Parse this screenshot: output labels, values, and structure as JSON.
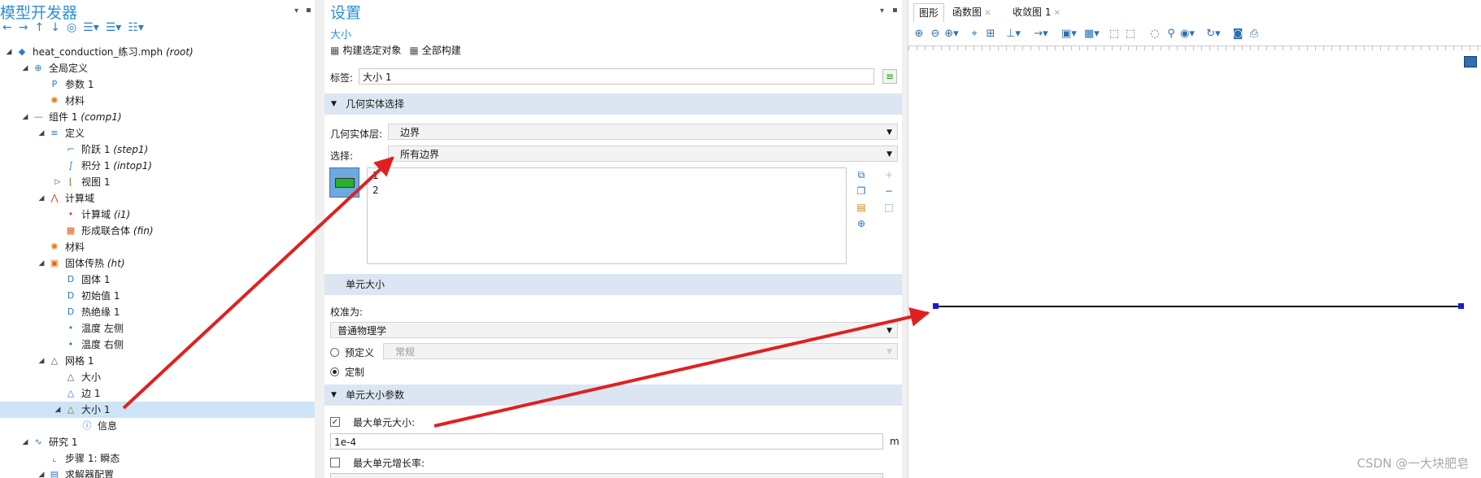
{
  "left": {
    "title": "模型开发器",
    "tree": [
      {
        "label": "heat_conduction_练习.mph",
        "tag": "(root)",
        "icon": "◆",
        "color": "#2b79c2",
        "level": 0,
        "exp": "◢"
      },
      {
        "label": "全局定义",
        "tag": "",
        "icon": "⊕",
        "color": "#2b79c2",
        "level": 1,
        "exp": "◢"
      },
      {
        "label": "参数 1",
        "tag": "",
        "icon": "P",
        "color": "#2b79c2",
        "level": 2,
        "exp": ""
      },
      {
        "label": "材料",
        "tag": "",
        "icon": "✺",
        "color": "#e07d10",
        "level": 2,
        "exp": ""
      },
      {
        "label": "组件 1",
        "tag": "(comp1)",
        "icon": "—",
        "color": "#2b79c2",
        "level": 1,
        "exp": "◢"
      },
      {
        "label": "定义",
        "tag": "",
        "icon": "≡",
        "color": "#2b79c2",
        "level": 2,
        "exp": "◢"
      },
      {
        "label": "阶跃 1",
        "tag": "(step1)",
        "icon": "⌐",
        "color": "#2b79c2",
        "level": 3,
        "exp": ""
      },
      {
        "label": "积分 1",
        "tag": "(intop1)",
        "icon": "∫",
        "color": "#2b79c2",
        "level": 3,
        "exp": ""
      },
      {
        "label": "视图 1",
        "tag": "",
        "icon": "⌊",
        "color": "#4a8a2a",
        "level": 3,
        "exp": "▷"
      },
      {
        "label": "计算域",
        "tag": "",
        "icon": "⋀",
        "color": "#d04020",
        "level": 2,
        "exp": "◢"
      },
      {
        "label": "计算域",
        "tag": "(i1)",
        "icon": "•",
        "color": "#d04020",
        "level": 3,
        "exp": ""
      },
      {
        "label": "形成联合体",
        "tag": "(fin)",
        "icon": "▦",
        "color": "#d06020",
        "level": 3,
        "exp": ""
      },
      {
        "label": "材料",
        "tag": "",
        "icon": "✺",
        "color": "#e07d10",
        "level": 2,
        "exp": ""
      },
      {
        "label": "固体传热",
        "tag": "(ht)",
        "icon": "▣",
        "color": "#e06a10",
        "level": 2,
        "exp": "◢"
      },
      {
        "label": "固体 1",
        "tag": "",
        "icon": "D",
        "color": "#2b79c2",
        "level": 3,
        "exp": ""
      },
      {
        "label": "初始值 1",
        "tag": "",
        "icon": "D",
        "color": "#2b79c2",
        "level": 3,
        "exp": ""
      },
      {
        "label": "热绝缘 1",
        "tag": "",
        "icon": "D",
        "color": "#2b79c2",
        "level": 3,
        "exp": ""
      },
      {
        "label": "温度 左侧",
        "tag": "",
        "icon": "•",
        "color": "#2b79c2",
        "level": 3,
        "exp": ""
      },
      {
        "label": "温度 右侧",
        "tag": "",
        "icon": "•",
        "color": "#2b79c2",
        "level": 3,
        "exp": ""
      },
      {
        "label": "网格 1",
        "tag": "",
        "icon": "△",
        "color": "#555555",
        "level": 2,
        "exp": "◢"
      },
      {
        "label": "大小",
        "tag": "",
        "icon": "△",
        "color": "#555555",
        "level": 3,
        "exp": ""
      },
      {
        "label": "边 1",
        "tag": "",
        "icon": "△",
        "color": "#2b79c2",
        "level": 3,
        "exp": ""
      },
      {
        "label": "大小 1",
        "tag": "",
        "icon": "△",
        "color": "#4a8a2a",
        "level": 3,
        "exp": "◢",
        "selected": true
      },
      {
        "label": "信息",
        "tag": "",
        "icon": "ⓘ",
        "color": "#2b79c2",
        "level": 4,
        "exp": ""
      },
      {
        "label": "研究 1",
        "tag": "",
        "icon": "∿",
        "color": "#2b79c2",
        "level": 1,
        "exp": "◢"
      },
      {
        "label": "步骤 1: 瞬态",
        "tag": "",
        "icon": "⌞",
        "color": "#2b79c2",
        "level": 2,
        "exp": ""
      },
      {
        "label": "求解器配置",
        "tag": "",
        "icon": "▤",
        "color": "#2b79c2",
        "level": 2,
        "exp": "◢"
      }
    ]
  },
  "mid": {
    "title": "设置",
    "subtitle": "大小",
    "build_selected": "构建选定对象",
    "build_all": "全部构建",
    "label_caption": "标签:",
    "label_value": "大小 1",
    "sec_geom": "几何实体选择",
    "geom_level_caption": "几何实体层:",
    "geom_level_value": "边界",
    "selection_caption": "选择:",
    "selection_value": "所有边界",
    "list_items": [
      "1",
      "2"
    ],
    "sec_elem_size": "单元大小",
    "calibrate_caption": "校准为:",
    "calibrate_value": "普通物理学",
    "predefined_label": "预定义",
    "predefined_value": "常规",
    "custom_label": "定制",
    "sec_params": "单元大小参数",
    "max_elem_label": "最大单元大小:",
    "max_elem_value": "1e-4",
    "max_elem_unit": "m",
    "max_growth_label": "最大单元增长率:"
  },
  "right": {
    "tabs": [
      "图形",
      "函数图",
      "收敛图 1"
    ],
    "watermark": "CSDN @一大块肥皂"
  },
  "colors": {
    "accent": "#2e8fd8",
    "arrow": "#e02020",
    "selection": "#cfe3f7",
    "section": "#dbe6f2"
  }
}
